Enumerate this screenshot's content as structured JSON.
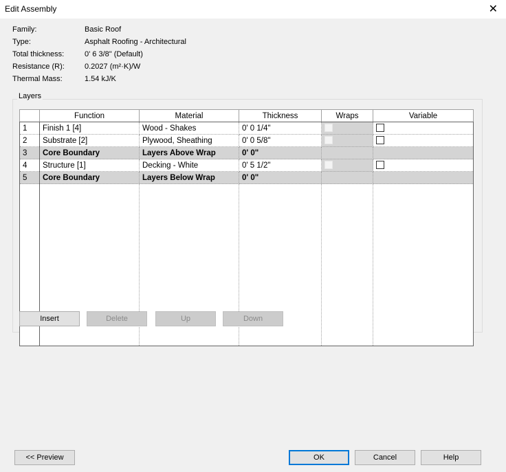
{
  "window": {
    "title": "Edit Assembly",
    "close_icon": "close-icon"
  },
  "properties": [
    {
      "label": "Family:",
      "value": "Basic Roof"
    },
    {
      "label": "Type:",
      "value": "Asphalt Roofing - Architectural"
    },
    {
      "label": "Total thickness:",
      "value": "0'  6 3/8\" (Default)"
    },
    {
      "label": "Resistance (R):",
      "value": "0.2027 (m²·K)/W"
    },
    {
      "label": "Thermal Mass:",
      "value": "1.54 kJ/K"
    }
  ],
  "layers": {
    "label": "Layers",
    "columns": [
      "Function",
      "Material",
      "Thickness",
      "Wraps",
      "Variable"
    ],
    "rows": [
      {
        "num": "1",
        "function": "Finish 1 [4]",
        "material": "Wood - Shakes",
        "thickness": "0'  0 1/4\"",
        "wraps": false,
        "variable": false
      },
      {
        "num": "2",
        "function": "Substrate [2]",
        "material": "Plywood, Sheathing",
        "thickness": "0'  0 5/8\"",
        "wraps": false,
        "variable": false
      },
      {
        "num": "3",
        "function": "Core Boundary",
        "material": "Layers Above Wrap",
        "thickness": "0'  0\""
      },
      {
        "num": "4",
        "function": "Structure [1]",
        "material": "Decking - White",
        "thickness": "0'  5 1/2\"",
        "wraps": false,
        "variable": false
      },
      {
        "num": "5",
        "function": "Core Boundary",
        "material": "Layers Below Wrap",
        "thickness": "0'  0\""
      }
    ],
    "buttons": {
      "insert": "Insert",
      "delete": "Delete",
      "up": "Up",
      "down": "Down"
    }
  },
  "footer": {
    "preview": "<< Preview",
    "ok": "OK",
    "cancel": "Cancel",
    "help": "Help"
  }
}
